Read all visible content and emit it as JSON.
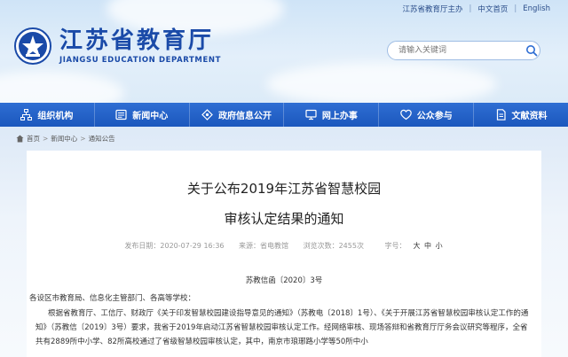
{
  "top_links": {
    "site": "江苏省教育厅主办",
    "cn": "中文首页",
    "en": "English"
  },
  "logo": {
    "cn": "江苏省教育厅",
    "en": "JIANGSU EDUCATION DEPARTMENT"
  },
  "search": {
    "placeholder": "请输入关键词"
  },
  "nav": [
    {
      "label": "组织机构",
      "icon": "org-chart-icon"
    },
    {
      "label": "新闻中心",
      "icon": "news-icon"
    },
    {
      "label": "政府信息公开",
      "icon": "info-disclosure-icon"
    },
    {
      "label": "网上办事",
      "icon": "online-service-icon"
    },
    {
      "label": "公众参与",
      "icon": "public-participation-icon"
    },
    {
      "label": "文献资料",
      "icon": "documents-icon"
    }
  ],
  "breadcrumb": {
    "home": "首页",
    "news": "新闻中心",
    "current": "通知公告"
  },
  "article": {
    "title_line1": "关于公布2019年江苏省智慧校园",
    "title_line2": "审核认定结果的通知",
    "meta": {
      "date": "发布日期：2020-07-29 16:36",
      "source": "来源：省电教馆",
      "views": "浏览次数：2455次",
      "fontsize_label": "字号：",
      "fs_big": "大",
      "fs_mid": "中",
      "fs_small": "小"
    },
    "doc_no": "苏教信函〔2020〕3号",
    "salutation": "各设区市教育局、信息化主管部门、各高等学校：",
    "body_start": "根据省教育厅、工信厅、财政厅",
    "body_link1": "《关于印发智慧校园建设指导意见的通知》",
    "body_mid1": "（苏教电〔2018〕1号）、",
    "body_link2": "《关于开展江苏省智慧校园审核认定工作的通知》",
    "body_mid2": "（苏教信〔2019〕3号）要求，我省于2019年启动江苏省智慧校园审核认定工作。经网络审核、现场答辩和省教育厅厅务会议研究等程序，全省共有2889所中小学、82所高校通过了省级智慧校园审核认定，其中，南京市琅琊路小学等50所中小"
  },
  "colors": {
    "nav_bg": "#1f5ec4",
    "brand_blue": "#1a4aa8"
  }
}
